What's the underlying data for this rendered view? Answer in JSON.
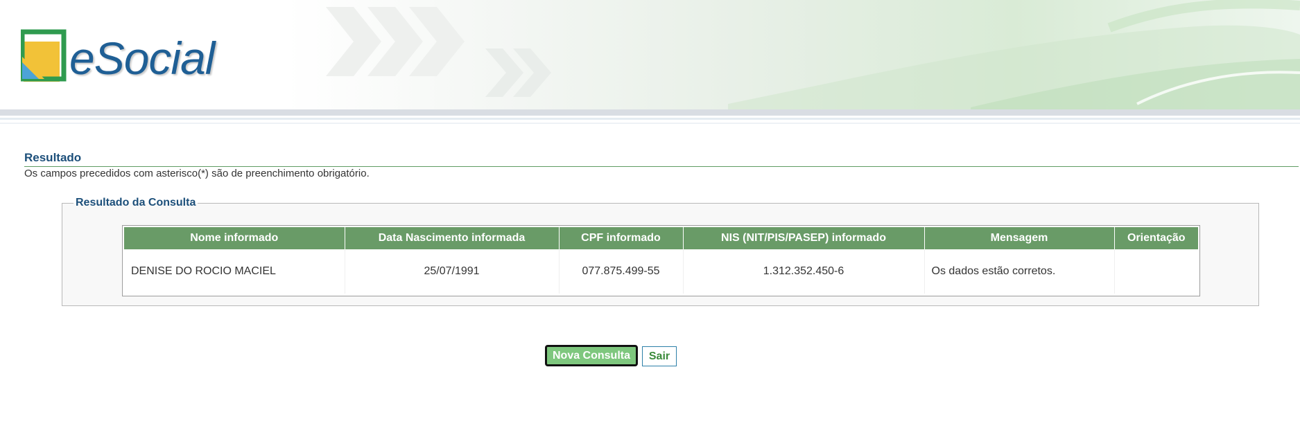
{
  "header": {
    "logo_text": "eSocial"
  },
  "section": {
    "title": "Resultado",
    "hint": "Os campos precedidos com asterisco(*) são de preenchimento obrigatório."
  },
  "result": {
    "legend": "Resultado da Consulta",
    "columns": [
      "Nome informado",
      "Data Nascimento informada",
      "CPF informado",
      "NIS (NIT/PIS/PASEP) informado",
      "Mensagem",
      "Orientação"
    ],
    "rows": [
      {
        "nome": "DENISE DO ROCIO MACIEL",
        "data_nascimento": "25/07/1991",
        "cpf": "077.875.499-55",
        "nis": "1.312.352.450-6",
        "mensagem": "Os dados estão corretos.",
        "orientacao": ""
      }
    ]
  },
  "actions": {
    "nova_consulta": "Nova Consulta",
    "sair": "Sair"
  },
  "colors": {
    "header_green": "#699b67",
    "title_blue": "#1c4f7a",
    "button_green": "#7ec77e"
  }
}
